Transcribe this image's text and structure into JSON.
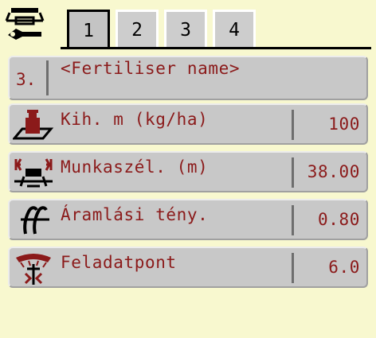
{
  "header": {
    "tabs": [
      {
        "label": "1",
        "active": true
      },
      {
        "label": "2",
        "active": false
      },
      {
        "label": "3",
        "active": false
      },
      {
        "label": "4",
        "active": false
      }
    ]
  },
  "name_row": {
    "index": "3.",
    "label": "<Fertiliser name>"
  },
  "rows": [
    {
      "label": "Kih. m (kg/ha)",
      "value": "100",
      "icon": "weight-icon"
    },
    {
      "label": "Munkaszél. (m)",
      "value": "38.00",
      "icon": "working-width-icon"
    },
    {
      "label": "Áramlási tény.",
      "value": "0.80",
      "icon": "flow-factor-icon"
    },
    {
      "label": "Feladatpont",
      "value": "6.0",
      "icon": "drop-point-icon"
    }
  ],
  "colors": {
    "background": "#f8f8cf",
    "text": "#8b1a1a",
    "row_background": "#c8c8c8"
  }
}
